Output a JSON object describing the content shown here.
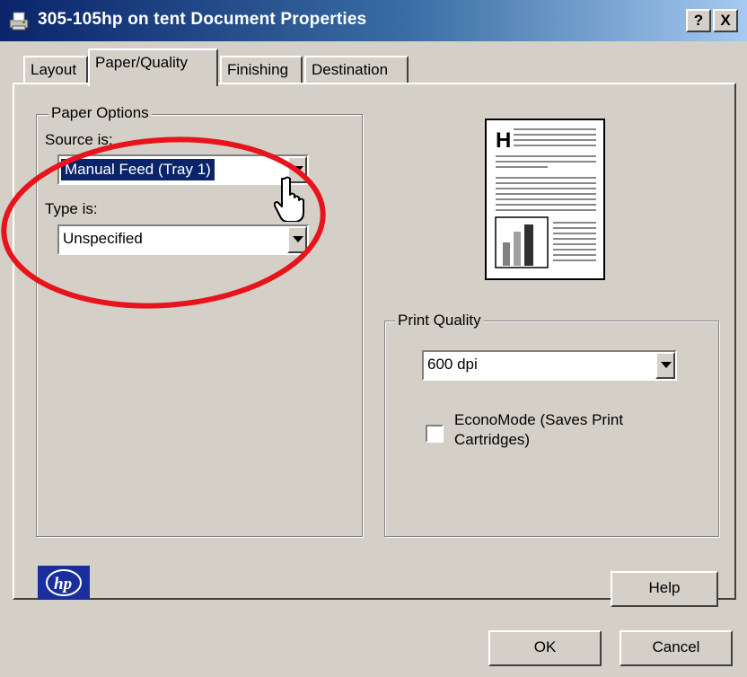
{
  "window": {
    "title": "305-105hp on tent Document Properties",
    "help_button": "?",
    "close_button": "X"
  },
  "tabs": [
    {
      "label": "Layout"
    },
    {
      "label": "Paper/Quality"
    },
    {
      "label": "Finishing"
    },
    {
      "label": "Destination"
    }
  ],
  "paper_options": {
    "group_label": "Paper Options",
    "source_label": "Source is:",
    "source_value": "Manual Feed (Tray 1)",
    "type_label": "Type is:",
    "type_value": "Unspecified"
  },
  "print_quality": {
    "group_label": "Print Quality",
    "resolution_value": "600 dpi",
    "economode_label_line1": "EconoMode (Saves Print",
    "economode_label_line2": "Cartridges)",
    "economode_checked": false
  },
  "preview": {
    "letter": "H"
  },
  "buttons": {
    "help": "Help",
    "ok": "OK",
    "cancel": "Cancel"
  },
  "colors": {
    "titlebar_start": "#0a246a",
    "selection": "#0a246a",
    "annotation_circle": "#e8141c",
    "hp_logo_blue": "#1a2f9c"
  },
  "icons": {
    "title": "printer-icon",
    "logo": "hp-logo",
    "cursor": "hand-pointer-icon"
  }
}
